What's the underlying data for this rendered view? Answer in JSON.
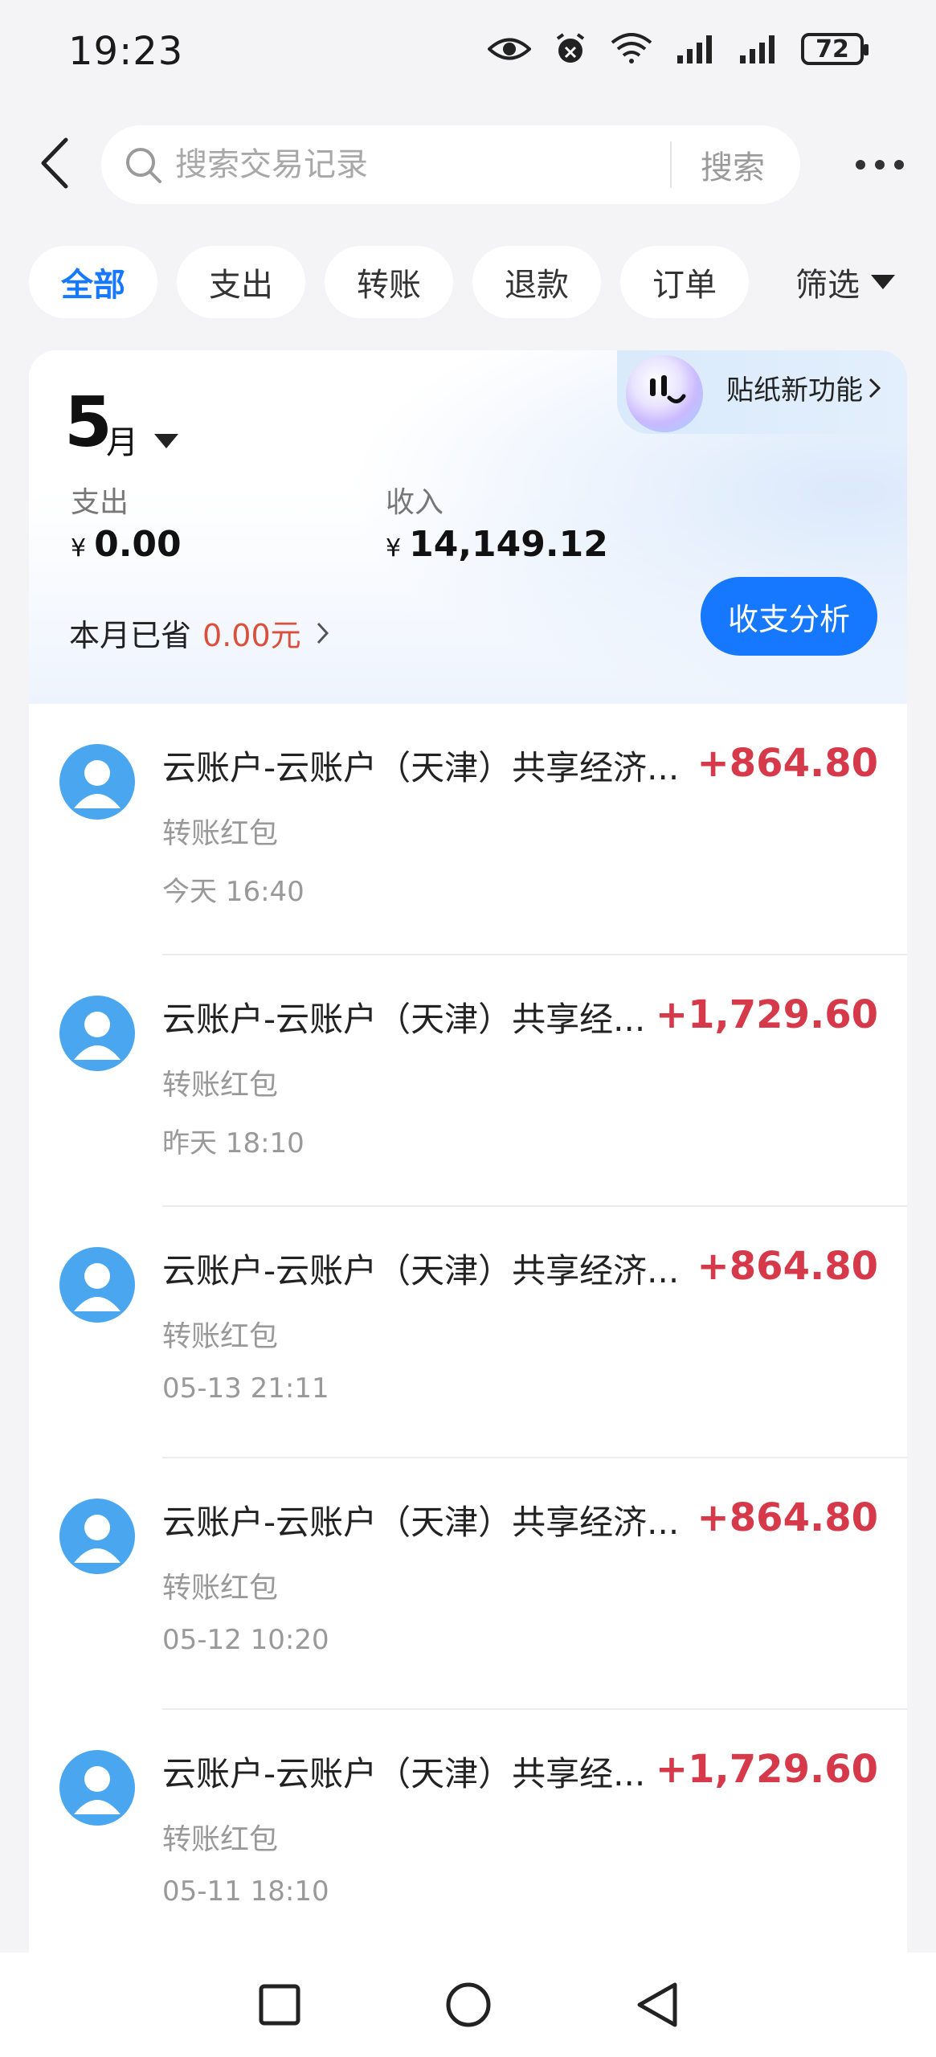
{
  "status_bar": {
    "time": "19:23",
    "battery": "72",
    "icons": [
      "eye-icon",
      "alarm-icon",
      "wifi-icon",
      "signal-icon",
      "signal-icon",
      "battery-icon"
    ]
  },
  "header": {
    "search_placeholder": "搜索交易记录",
    "search_button": "搜索"
  },
  "tabs": [
    {
      "label": "全部",
      "active": true
    },
    {
      "label": "支出",
      "active": false
    },
    {
      "label": "转账",
      "active": false
    },
    {
      "label": "退款",
      "active": false
    },
    {
      "label": "订单",
      "active": false
    }
  ],
  "filter_label": "筛选",
  "summary": {
    "month_number": "5",
    "month_unit": "月",
    "expense_label": "支出",
    "income_label": "收入",
    "currency_symbol": "¥",
    "expense_value": "0.00",
    "income_value": "14,149.12",
    "saved_label": "本月已省",
    "saved_value": "0.00元",
    "analyze_button": "收支分析",
    "sticker_label": "贴纸新功能"
  },
  "transactions": [
    {
      "title": "云账户-云账户（天津）共享经济...",
      "amount": "+864.80",
      "type": "转账红包",
      "time": "今天 16:40"
    },
    {
      "title": "云账户-云账户（天津）共享经...",
      "amount": "+1,729.60",
      "type": "转账红包",
      "time": "昨天 18:10"
    },
    {
      "title": "云账户-云账户（天津）共享经济...",
      "amount": "+864.80",
      "type": "转账红包",
      "time": "05-13 21:11"
    },
    {
      "title": "云账户-云账户（天津）共享经济...",
      "amount": "+864.80",
      "type": "转账红包",
      "time": "05-12 10:20"
    },
    {
      "title": "云账户-云账户（天津）共享经...",
      "amount": "+1,729.60",
      "type": "转账红包",
      "time": "05-11 18:10"
    }
  ],
  "colors": {
    "accent": "#1677ff",
    "amount": "#d6394a",
    "saved": "#d9503c",
    "avatar": "#4aa6ee"
  }
}
